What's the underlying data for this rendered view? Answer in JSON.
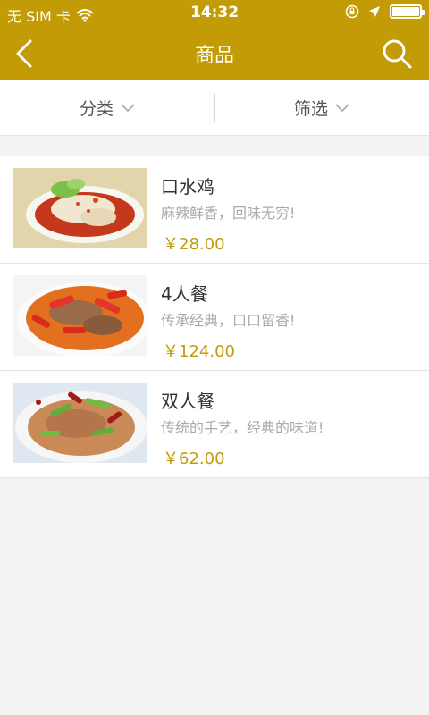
{
  "status": {
    "carrier": "无 SIM 卡",
    "time": "14:32"
  },
  "nav": {
    "title": "商品",
    "back_icon": "back-arrow-icon",
    "search_icon": "search-icon"
  },
  "filters": {
    "category_label": "分类",
    "filter_label": "筛选"
  },
  "products": [
    {
      "name": "口水鸡",
      "description": "麻辣鲜香，回味无穷!",
      "price": "￥28.00"
    },
    {
      "name": "4人餐",
      "description": "传承经典，口口留香!",
      "price": "￥124.00"
    },
    {
      "name": "双人餐",
      "description": "传统的手艺，经典的味道!",
      "price": "￥62.00"
    }
  ],
  "colors": {
    "accent": "#c29b06",
    "background": "#f3f3f3"
  }
}
